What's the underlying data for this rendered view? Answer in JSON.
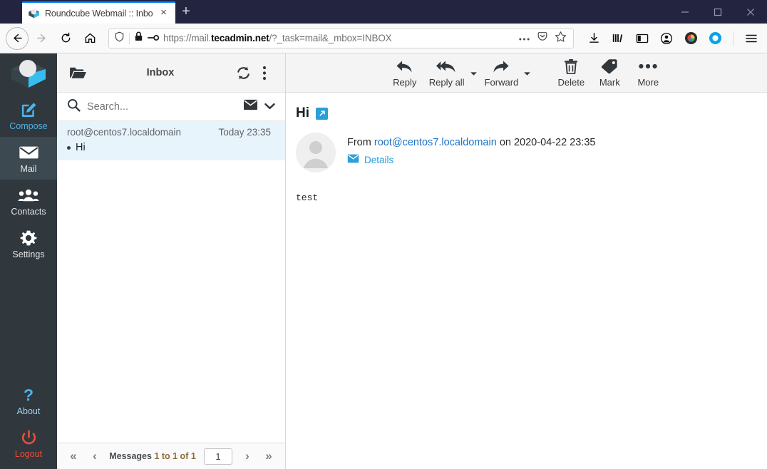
{
  "browser": {
    "tab": {
      "title": "Roundcube Webmail :: Inbox",
      "favicon": "roundcube-logo-icon",
      "close": "×"
    },
    "newtab_label": "+",
    "window_controls": [
      {
        "name": "minimize-button",
        "glyph": "minimize-icon"
      },
      {
        "name": "maximize-button",
        "glyph": "maximize-icon"
      },
      {
        "name": "close-window-button",
        "glyph": "close-icon"
      }
    ],
    "nav": {
      "back": "back-arrow-icon",
      "forward": "forward-arrow-icon",
      "reload": "reload-icon",
      "home": "home-icon"
    },
    "url": {
      "scheme": "https://mail.",
      "domain": "tecadmin.net",
      "path": "/?_task=mail&_mbox=INBOX",
      "full": "https://mail.tecadmin.net/?_task=mail&_mbox=INBOX",
      "shield_icon": "tracking-protection-shield-icon",
      "lock_icon": "padlock-icon",
      "key_icon": "key-icon",
      "more_icon": "page-actions-ellipsis-icon",
      "pocket_icon": "pocket-icon",
      "bookmark_icon": "star-icon"
    },
    "toolbar_icons": [
      {
        "name": "downloads-icon",
        "label": "Downloads"
      },
      {
        "name": "library-icon",
        "label": "Library"
      },
      {
        "name": "sidebar-icon",
        "label": "Sidebars"
      },
      {
        "name": "account-icon",
        "label": "Account"
      },
      {
        "name": "extension-color-icon",
        "label": "Extension"
      },
      {
        "name": "extension-blue-circle-icon",
        "label": "Extension"
      },
      {
        "name": "hamburger-menu-icon",
        "label": "Open menu"
      }
    ]
  },
  "colors": {
    "titlebar": "#23243f",
    "tab_accent": "#0a84ff",
    "sidebar_bg": "#30373d",
    "sidebar_active": "#3d4950",
    "accent_blue": "#4db2ec",
    "link_blue": "#1a73c7",
    "logout_red": "#e8503a",
    "selected_row": "#e8f4fb",
    "toolbar_bg": "#f4f4f4"
  },
  "sidebar": {
    "logo_name": "roundcube-logo",
    "items": [
      {
        "label": "Compose",
        "icon": "compose-pencil-icon",
        "state": "accent"
      },
      {
        "label": "Mail",
        "icon": "envelope-icon",
        "state": "active"
      },
      {
        "label": "Contacts",
        "icon": "contacts-people-icon",
        "state": "normal"
      },
      {
        "label": "Settings",
        "icon": "gear-icon",
        "state": "normal"
      }
    ],
    "bottom_items": [
      {
        "label": "About",
        "icon": "question-mark-icon",
        "state": "about"
      },
      {
        "label": "Logout",
        "icon": "power-icon",
        "state": "logout"
      }
    ]
  },
  "maillist": {
    "folder_icon": "folder-open-icon",
    "title": "Inbox",
    "refresh_icon": "refresh-icon",
    "options_icon": "three-dots-vertical-icon",
    "search": {
      "icon": "search-icon",
      "placeholder": "Search...",
      "value": "",
      "scope_icon": "envelope-icon",
      "chevron_icon": "chevron-down-icon"
    },
    "messages": [
      {
        "from": "root@centos7.localdomain",
        "date": "Today 23:35",
        "subject": "Hi",
        "unread": true,
        "selected": true
      }
    ],
    "pager": {
      "first_icon": "«",
      "prev_icon": "‹",
      "status_prefix": "Messages ",
      "status_range": "1 to 1 of 1",
      "status_full": "Messages 1 to 1 of 1",
      "page_value": "1",
      "next_icon": "›",
      "last_icon": "»"
    }
  },
  "toolbar": {
    "buttons": [
      {
        "label": "Reply",
        "icon": "reply-arrow-icon",
        "has_dropdown": false
      },
      {
        "label": "Reply all",
        "icon": "reply-all-arrow-icon",
        "has_dropdown": true
      },
      {
        "label": "Forward",
        "icon": "forward-arrow-icon",
        "has_dropdown": true
      },
      {
        "label": "Delete",
        "icon": "trash-icon",
        "has_dropdown": false
      },
      {
        "label": "Mark",
        "icon": "tag-icon",
        "has_dropdown": false
      },
      {
        "label": "More",
        "icon": "ellipsis-horizontal-icon",
        "has_dropdown": false
      }
    ]
  },
  "message": {
    "subject": "Hi",
    "open_icon": "open-in-new-window-icon",
    "avatar_icon": "default-user-avatar-icon",
    "from_label": "From",
    "from_address": "root@centos7.localdomain",
    "on_label": "on",
    "datetime": "2020-04-22 23:35",
    "details_label": "Details",
    "details_icon": "envelope-icon",
    "body": "test"
  }
}
